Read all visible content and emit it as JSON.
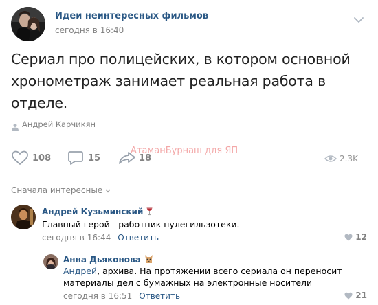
{
  "post": {
    "group_name": "Идеи неинтересных фильмов",
    "time": "сегодня в 16:40",
    "text": "Сериал про полицейских, в котором основной хронометраж занимает реальная работа в отделе.",
    "author": "Андрей Карчикян",
    "likes": "108",
    "comments": "15",
    "shares": "18",
    "views": "2.3K",
    "watermark": "АтаманБурнаш для ЯП"
  },
  "comments_section": {
    "sort_label": "Сначала интересные"
  },
  "comments": [
    {
      "name": "Андрей Кузьминский",
      "text": "Главный герой - работник пулегильзотеки.",
      "time": "сегодня в 16:44",
      "reply": "Ответить",
      "likes": "12",
      "emoji": "wine-glass-icon"
    },
    {
      "name": "Анна Дьяконова",
      "reply_to": "Андрей",
      "text": ", архива. На протяжении всего сериала он переносит материалы дел с бумажных на электронные носители",
      "time": "сегодня в 16:51",
      "reply": "Ответить",
      "likes": "21",
      "emoji": "cat-icon"
    }
  ],
  "colors": {
    "link": "#2a5885",
    "muted": "#828282",
    "divider": "#e7e8ec"
  }
}
